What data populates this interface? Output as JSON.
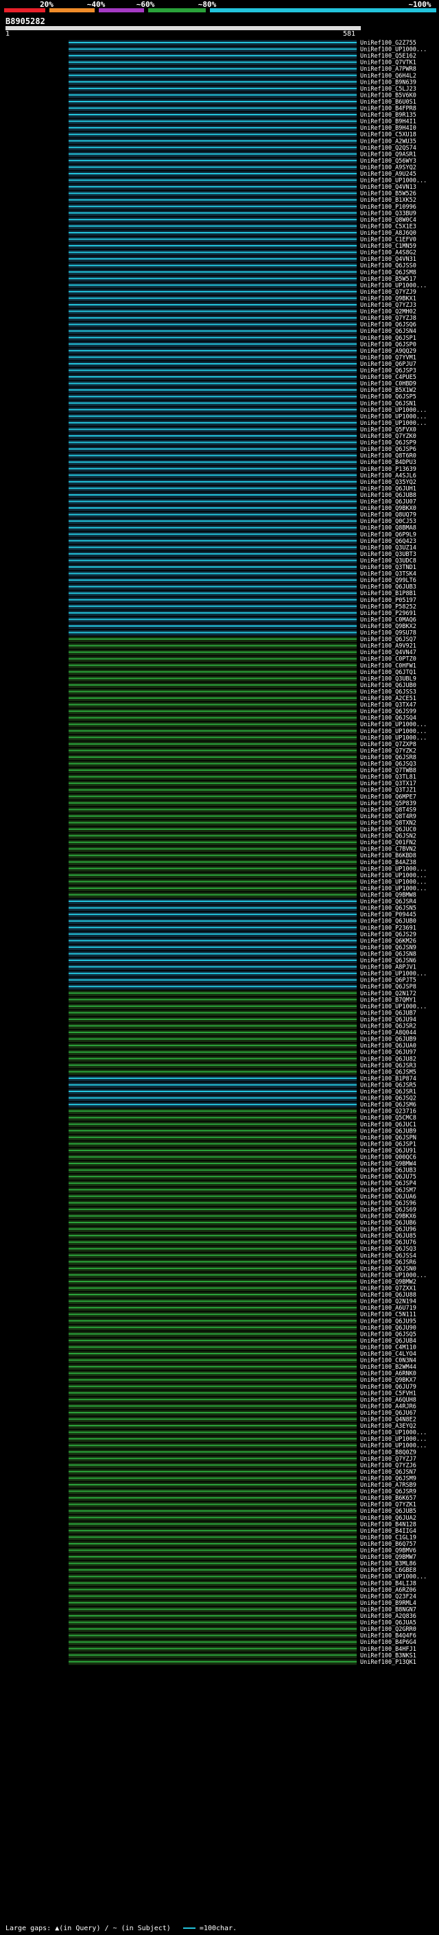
{
  "scale": {
    "labels": [
      "20%",
      "~40%",
      "~60%",
      "~80%",
      "~100%"
    ],
    "colors": [
      "#e8202a",
      "#f08c2a",
      "#a53ac4",
      "#2aa23a",
      "#23c4dc"
    ]
  },
  "query": {
    "id": "B8905282",
    "start": "1",
    "end": "581"
  },
  "colors": {
    "identity_high": "#23c4dc",
    "identity_mid": "#2aa23a",
    "background": "#000000"
  },
  "hits": [
    {
      "label": "UniRef100_G2Z755",
      "id": "high"
    },
    {
      "label": "UniRef100_UP1000...",
      "id": "high"
    },
    {
      "label": "UniRef100_Q5E162",
      "id": "high"
    },
    {
      "label": "UniRef100_Q7VTK1",
      "id": "high"
    },
    {
      "label": "UniRef100_A7PWR8",
      "id": "high"
    },
    {
      "label": "UniRef100_Q6H4L2",
      "id": "high"
    },
    {
      "label": "UniRef100_B9N639",
      "id": "high"
    },
    {
      "label": "UniRef100_C5LJ23",
      "id": "high"
    },
    {
      "label": "UniRef100_B5V6K0",
      "id": "high"
    },
    {
      "label": "UniRef100_B6U0S1",
      "id": "high"
    },
    {
      "label": "UniRef100_B4FPR8",
      "id": "high"
    },
    {
      "label": "UniRef100_B9R135",
      "id": "high"
    },
    {
      "label": "UniRef100_B9H4I1",
      "id": "high"
    },
    {
      "label": "UniRef100_B9H4I0",
      "id": "high"
    },
    {
      "label": "UniRef100_C5XU18",
      "id": "high"
    },
    {
      "label": "UniRef100_A2WU35",
      "id": "high"
    },
    {
      "label": "UniRef100_Q2QS74",
      "id": "high"
    },
    {
      "label": "UniRef100_Q9ASR1",
      "id": "high"
    },
    {
      "label": "UniRef100_Q56WY3",
      "id": "high"
    },
    {
      "label": "UniRef100_A9SYQ2",
      "id": "high"
    },
    {
      "label": "UniRef100_A9U245",
      "id": "high"
    },
    {
      "label": "UniRef100_UP1000...",
      "id": "high"
    },
    {
      "label": "UniRef100_Q4VN13",
      "id": "high"
    },
    {
      "label": "UniRef100_B5W526",
      "id": "high"
    },
    {
      "label": "UniRef100_B1XK52",
      "id": "high"
    },
    {
      "label": "UniRef100_P10996",
      "id": "high"
    },
    {
      "label": "UniRef100_Q33BU9",
      "id": "high"
    },
    {
      "label": "UniRef100_Q8W0C4",
      "id": "high"
    },
    {
      "label": "UniRef100_C5X1E3",
      "id": "high"
    },
    {
      "label": "UniRef100_A8J6Q0",
      "id": "high"
    },
    {
      "label": "UniRef100_C1EFV0",
      "id": "high"
    },
    {
      "label": "UniRef100_C1MN59",
      "id": "high"
    },
    {
      "label": "UniRef100_A4S8G2",
      "id": "high"
    },
    {
      "label": "UniRef100_Q4VN31",
      "id": "high"
    },
    {
      "label": "UniRef100_Q6JSS0",
      "id": "high"
    },
    {
      "label": "UniRef100_Q6JSM8",
      "id": "high"
    },
    {
      "label": "UniRef100_B5W517",
      "id": "high"
    },
    {
      "label": "UniRef100_UP1000...",
      "id": "high"
    },
    {
      "label": "UniRef100_Q7YZJ9",
      "id": "high"
    },
    {
      "label": "UniRef100_Q9BKX1",
      "id": "high"
    },
    {
      "label": "UniRef100_Q7YZJ3",
      "id": "high"
    },
    {
      "label": "UniRef100_Q2MH02",
      "id": "high"
    },
    {
      "label": "UniRef100_Q7YZJ8",
      "id": "high"
    },
    {
      "label": "UniRef100_Q6JSQ6",
      "id": "high"
    },
    {
      "label": "UniRef100_Q6JSN4",
      "id": "high"
    },
    {
      "label": "UniRef100_Q6JSP1",
      "id": "high"
    },
    {
      "label": "UniRef100_Q6JSP0",
      "id": "high"
    },
    {
      "label": "UniRef100_A9QQ29",
      "id": "high"
    },
    {
      "label": "UniRef100_Q7YVM1",
      "id": "high"
    },
    {
      "label": "UniRef100_Q6PJU7",
      "id": "high"
    },
    {
      "label": "UniRef100_Q6JSP3",
      "id": "high"
    },
    {
      "label": "UniRef100_C4PUE5",
      "id": "high"
    },
    {
      "label": "UniRef100_C0HBD9",
      "id": "high"
    },
    {
      "label": "UniRef100_B5X1W2",
      "id": "high"
    },
    {
      "label": "UniRef100_Q6JSP5",
      "id": "high"
    },
    {
      "label": "UniRef100_Q6JSN1",
      "id": "high"
    },
    {
      "label": "UniRef100_UP1000...",
      "id": "high"
    },
    {
      "label": "UniRef100_UP1000...",
      "id": "high"
    },
    {
      "label": "UniRef100_UP1000...",
      "id": "high"
    },
    {
      "label": "UniRef100_Q5FVX0",
      "id": "high"
    },
    {
      "label": "UniRef100_Q7YZK0",
      "id": "high"
    },
    {
      "label": "UniRef100_Q6JSP9",
      "id": "high"
    },
    {
      "label": "UniRef100_Q6JSP6",
      "id": "high"
    },
    {
      "label": "UniRef100_Q8T6R0",
      "id": "high"
    },
    {
      "label": "UniRef100_B4DPU3",
      "id": "high"
    },
    {
      "label": "UniRef100_P13639",
      "id": "high"
    },
    {
      "label": "UniRef100_A4SJL6",
      "id": "high"
    },
    {
      "label": "UniRef100_Q35YQ2",
      "id": "high"
    },
    {
      "label": "UniRef100_Q6JUH1",
      "id": "high"
    },
    {
      "label": "UniRef100_Q6JUB8",
      "id": "high"
    },
    {
      "label": "UniRef100_Q6JU07",
      "id": "high"
    },
    {
      "label": "UniRef100_Q9BKX0",
      "id": "high"
    },
    {
      "label": "UniRef100_Q8UQ79",
      "id": "high"
    },
    {
      "label": "UniRef100_Q0CJ53",
      "id": "high"
    },
    {
      "label": "UniRef100_Q8BMA8",
      "id": "high"
    },
    {
      "label": "UniRef100_Q6P9L9",
      "id": "high"
    },
    {
      "label": "UniRef100_Q6Q423",
      "id": "high"
    },
    {
      "label": "UniRef100_Q3UZ14",
      "id": "high"
    },
    {
      "label": "UniRef100_Q3UBT3",
      "id": "high"
    },
    {
      "label": "UniRef100_Q3UDC8",
      "id": "high"
    },
    {
      "label": "UniRef100_Q3TND1",
      "id": "high"
    },
    {
      "label": "UniRef100_Q3TSK4",
      "id": "high"
    },
    {
      "label": "UniRef100_Q99LT6",
      "id": "high"
    },
    {
      "label": "UniRef100_Q6JUB3",
      "id": "high"
    },
    {
      "label": "UniRef100_B1P8B1",
      "id": "high"
    },
    {
      "label": "UniRef100_P05197",
      "id": "high"
    },
    {
      "label": "UniRef100_P58252",
      "id": "high"
    },
    {
      "label": "UniRef100_P29691",
      "id": "high"
    },
    {
      "label": "UniRef100_C0MAQ6",
      "id": "high"
    },
    {
      "label": "UniRef100_Q9BKX2",
      "id": "high"
    },
    {
      "label": "UniRef100_Q9SU78",
      "id": "high"
    },
    {
      "label": "UniRef100_Q6JSQ7",
      "id": "mid"
    },
    {
      "label": "UniRef100_A9V921",
      "id": "mid"
    },
    {
      "label": "UniRef100_Q4VN47",
      "id": "mid"
    },
    {
      "label": "UniRef100_C0PTZ0",
      "id": "mid"
    },
    {
      "label": "UniRef100_C0HFW1",
      "id": "mid"
    },
    {
      "label": "UniRef100_Q6JTQ1",
      "id": "mid"
    },
    {
      "label": "UniRef100_Q3UBL9",
      "id": "mid"
    },
    {
      "label": "UniRef100_Q6JUB0",
      "id": "mid"
    },
    {
      "label": "UniRef100_Q6JSS3",
      "id": "mid"
    },
    {
      "label": "UniRef100_A2CE51",
      "id": "mid"
    },
    {
      "label": "UniRef100_Q3TX47",
      "id": "mid"
    },
    {
      "label": "UniRef100_Q6JS99",
      "id": "mid"
    },
    {
      "label": "UniRef100_Q6JSQ4",
      "id": "mid"
    },
    {
      "label": "UniRef100_UP1000...",
      "id": "mid"
    },
    {
      "label": "UniRef100_UP1000...",
      "id": "mid"
    },
    {
      "label": "UniRef100_UP1000...",
      "id": "mid"
    },
    {
      "label": "UniRef100_Q7ZXP8",
      "id": "mid"
    },
    {
      "label": "UniRef100_Q7YZK2",
      "id": "mid"
    },
    {
      "label": "UniRef100_Q6JSR8",
      "id": "mid"
    },
    {
      "label": "UniRef100_Q6JSQ3",
      "id": "mid"
    },
    {
      "label": "UniRef100_Q7TWB8",
      "id": "mid"
    },
    {
      "label": "UniRef100_Q3TL81",
      "id": "mid"
    },
    {
      "label": "UniRef100_Q3TX17",
      "id": "mid"
    },
    {
      "label": "UniRef100_Q3TJZ1",
      "id": "mid"
    },
    {
      "label": "UniRef100_Q6MPE7",
      "id": "mid"
    },
    {
      "label": "UniRef100_Q5P839",
      "id": "mid"
    },
    {
      "label": "UniRef100_Q8T4S9",
      "id": "mid"
    },
    {
      "label": "UniRef100_Q8T4R9",
      "id": "mid"
    },
    {
      "label": "UniRef100_Q8TXN2",
      "id": "mid"
    },
    {
      "label": "UniRef100_Q6JUC0",
      "id": "mid"
    },
    {
      "label": "UniRef100_Q6JSN2",
      "id": "mid"
    },
    {
      "label": "UniRef100_Q01FN2",
      "id": "mid"
    },
    {
      "label": "UniRef100_C7BVN2",
      "id": "mid"
    },
    {
      "label": "UniRef100_B6KBD8",
      "id": "mid"
    },
    {
      "label": "UniRef100_B4AZ38",
      "id": "mid"
    },
    {
      "label": "UniRef100_UP1000...",
      "id": "mid"
    },
    {
      "label": "UniRef100_UP1000...",
      "id": "mid"
    },
    {
      "label": "UniRef100_UP1000...",
      "id": "mid"
    },
    {
      "label": "UniRef100_UP1000...",
      "id": "mid"
    },
    {
      "label": "UniRef100_Q9BMW8",
      "id": "mid"
    },
    {
      "label": "UniRef100_Q6JSR4",
      "id": "high"
    },
    {
      "label": "UniRef100_Q6JSN5",
      "id": "high"
    },
    {
      "label": "UniRef100_P09445",
      "id": "high"
    },
    {
      "label": "UniRef100_Q6JUB0",
      "id": "high"
    },
    {
      "label": "UniRef100_P23691",
      "id": "high"
    },
    {
      "label": "UniRef100_Q6JS29",
      "id": "high"
    },
    {
      "label": "UniRef100_Q6KM26",
      "id": "high"
    },
    {
      "label": "UniRef100_Q6JSN9",
      "id": "high"
    },
    {
      "label": "UniRef100_Q6JSN8",
      "id": "high"
    },
    {
      "label": "UniRef100_Q6JSN6",
      "id": "high"
    },
    {
      "label": "UniRef100_A8PJV1",
      "id": "high"
    },
    {
      "label": "UniRef100_UP1000...",
      "id": "high"
    },
    {
      "label": "UniRef100_Q6PJT5",
      "id": "high"
    },
    {
      "label": "UniRef100_Q6JSP8",
      "id": "high"
    },
    {
      "label": "UniRef100_Q2N172",
      "id": "mid"
    },
    {
      "label": "UniRef100_B7QMY1",
      "id": "mid"
    },
    {
      "label": "UniRef100_UP1000...",
      "id": "mid"
    },
    {
      "label": "UniRef100_Q6JUB7",
      "id": "mid"
    },
    {
      "label": "UniRef100_Q6JU94",
      "id": "mid"
    },
    {
      "label": "UniRef100_Q6JSR2",
      "id": "mid"
    },
    {
      "label": "UniRef100_A8Q044",
      "id": "mid"
    },
    {
      "label": "UniRef100_Q6JUB9",
      "id": "mid"
    },
    {
      "label": "UniRef100_Q6JUA0",
      "id": "mid"
    },
    {
      "label": "UniRef100_Q6JU97",
      "id": "mid"
    },
    {
      "label": "UniRef100_Q6JU82",
      "id": "mid"
    },
    {
      "label": "UniRef100_Q6JSR3",
      "id": "mid"
    },
    {
      "label": "UniRef100_Q6JSM5",
      "id": "mid"
    },
    {
      "label": "UniRef100_B1P874",
      "id": "high"
    },
    {
      "label": "UniRef100_Q6JSR5",
      "id": "high"
    },
    {
      "label": "UniRef100_Q6JSR1",
      "id": "high"
    },
    {
      "label": "UniRef100_Q6JSQ2",
      "id": "high"
    },
    {
      "label": "UniRef100_Q6JSM6",
      "id": "high"
    },
    {
      "label": "UniRef100_Q23716",
      "id": "mid"
    },
    {
      "label": "UniRef100_Q5CMC8",
      "id": "mid"
    },
    {
      "label": "UniRef100_Q6JUC1",
      "id": "mid"
    },
    {
      "label": "UniRef100_Q6JUB9",
      "id": "mid"
    },
    {
      "label": "UniRef100_Q6JSPN",
      "id": "mid"
    },
    {
      "label": "UniRef100_Q6JSP1",
      "id": "mid"
    },
    {
      "label": "UniRef100_Q6JU91",
      "id": "mid"
    },
    {
      "label": "UniRef100_Q00QC6",
      "id": "mid"
    },
    {
      "label": "UniRef100_Q9BMW4",
      "id": "mid"
    },
    {
      "label": "UniRef100_Q6JUB3",
      "id": "mid"
    },
    {
      "label": "UniRef100_Q6JU75",
      "id": "mid"
    },
    {
      "label": "UniRef100_Q6JSP4",
      "id": "mid"
    },
    {
      "label": "UniRef100_Q6JSM7",
      "id": "mid"
    },
    {
      "label": "UniRef100_Q6JUA6",
      "id": "mid"
    },
    {
      "label": "UniRef100_Q6JS96",
      "id": "mid"
    },
    {
      "label": "UniRef100_Q6JS69",
      "id": "mid"
    },
    {
      "label": "UniRef100_Q9BKX6",
      "id": "mid"
    },
    {
      "label": "UniRef100_Q6JUB6",
      "id": "mid"
    },
    {
      "label": "UniRef100_Q6JU96",
      "id": "mid"
    },
    {
      "label": "UniRef100_Q6JU85",
      "id": "mid"
    },
    {
      "label": "UniRef100_Q6JU76",
      "id": "mid"
    },
    {
      "label": "UniRef100_Q6JSQ3",
      "id": "mid"
    },
    {
      "label": "UniRef100_Q6JSS4",
      "id": "mid"
    },
    {
      "label": "UniRef100_Q6JSR6",
      "id": "mid"
    },
    {
      "label": "UniRef100_Q6JSN0",
      "id": "mid"
    },
    {
      "label": "UniRef100_UP1000...",
      "id": "mid"
    },
    {
      "label": "UniRef100_Q9BMW2",
      "id": "mid"
    },
    {
      "label": "UniRef100_Q7ZXX1",
      "id": "mid"
    },
    {
      "label": "UniRef100_Q6JU88",
      "id": "mid"
    },
    {
      "label": "UniRef100_Q2N194",
      "id": "mid"
    },
    {
      "label": "UniRef100_A6U719",
      "id": "mid"
    },
    {
      "label": "UniRef100_C5N111",
      "id": "mid"
    },
    {
      "label": "UniRef100_Q6JU95",
      "id": "mid"
    },
    {
      "label": "UniRef100_Q6JU90",
      "id": "mid"
    },
    {
      "label": "UniRef100_Q6JSQ5",
      "id": "mid"
    },
    {
      "label": "UniRef100_Q6JUB4",
      "id": "mid"
    },
    {
      "label": "UniRef100_C4M110",
      "id": "mid"
    },
    {
      "label": "UniRef100_C4LYO4",
      "id": "mid"
    },
    {
      "label": "UniRef100_C0N3N4",
      "id": "mid"
    },
    {
      "label": "UniRef100_B2WM44",
      "id": "mid"
    },
    {
      "label": "UniRef100_A6RNK0",
      "id": "mid"
    },
    {
      "label": "UniRef100_Q9BKX7",
      "id": "mid"
    },
    {
      "label": "UniRef100_Q6JU79",
      "id": "mid"
    },
    {
      "label": "UniRef100_C5FVH1",
      "id": "mid"
    },
    {
      "label": "UniRef100_A6QUH8",
      "id": "mid"
    },
    {
      "label": "UniRef100_A4RJR6",
      "id": "mid"
    },
    {
      "label": "UniRef100_Q6JU67",
      "id": "mid"
    },
    {
      "label": "UniRef100_Q4N8E2",
      "id": "mid"
    },
    {
      "label": "UniRef100_A3EYQ2",
      "id": "mid"
    },
    {
      "label": "UniRef100_UP1000...",
      "id": "mid"
    },
    {
      "label": "UniRef100_UP1000...",
      "id": "mid"
    },
    {
      "label": "UniRef100_UP1000...",
      "id": "mid"
    },
    {
      "label": "UniRef100_B8Q0Z9",
      "id": "mid"
    },
    {
      "label": "UniRef100_Q7YZJ7",
      "id": "mid"
    },
    {
      "label": "UniRef100_Q7YZJ6",
      "id": "mid"
    },
    {
      "label": "UniRef100_Q6JSN7",
      "id": "mid"
    },
    {
      "label": "UniRef100_Q6JSM9",
      "id": "mid"
    },
    {
      "label": "UniRef100_A7RSB9",
      "id": "mid"
    },
    {
      "label": "UniRef100_Q6JSR9",
      "id": "mid"
    },
    {
      "label": "UniRef100_B6K657",
      "id": "mid"
    },
    {
      "label": "UniRef100_Q7YZK1",
      "id": "mid"
    },
    {
      "label": "UniRef100_Q6JUB5",
      "id": "mid"
    },
    {
      "label": "UniRef100_Q6JUA2",
      "id": "mid"
    },
    {
      "label": "UniRef100_B4N128",
      "id": "mid"
    },
    {
      "label": "UniRef100_B4IIG4",
      "id": "mid"
    },
    {
      "label": "UniRef100_C1GL19",
      "id": "mid"
    },
    {
      "label": "UniRef100_B6Q757",
      "id": "mid"
    },
    {
      "label": "UniRef100_Q9BMV6",
      "id": "mid"
    },
    {
      "label": "UniRef100_Q9BMW7",
      "id": "mid"
    },
    {
      "label": "UniRef100_B3ML86",
      "id": "mid"
    },
    {
      "label": "UniRef100_C6GBE8",
      "id": "mid"
    },
    {
      "label": "UniRef100_UP1000...",
      "id": "mid"
    },
    {
      "label": "UniRef100_B4LIJ8",
      "id": "mid"
    },
    {
      "label": "UniRef100_A6RZ06",
      "id": "mid"
    },
    {
      "label": "UniRef100_Q23F24",
      "id": "mid"
    },
    {
      "label": "UniRef100_B9RML4",
      "id": "mid"
    },
    {
      "label": "UniRef100_B8NGN7",
      "id": "mid"
    },
    {
      "label": "UniRef100_A2Q836",
      "id": "mid"
    },
    {
      "label": "UniRef100_Q6JUA5",
      "id": "mid"
    },
    {
      "label": "UniRef100_Q2GRR0",
      "id": "mid"
    },
    {
      "label": "UniRef100_B4Q4F6",
      "id": "mid"
    },
    {
      "label": "UniRef100_B4P6G4",
      "id": "mid"
    },
    {
      "label": "UniRef100_B4HFJ1",
      "id": "mid"
    },
    {
      "label": "UniRef100_B3NKS1",
      "id": "mid"
    },
    {
      "label": "UniRef100_P13QK1",
      "id": "mid"
    }
  ],
  "legend": {
    "text": "Large gaps: ▲(in Query) / ~ (in Subject)",
    "scale_text": "=100char."
  }
}
